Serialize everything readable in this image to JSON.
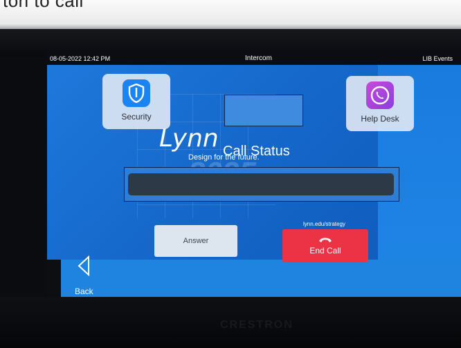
{
  "caption": {
    "text": "ton to call"
  },
  "topbar": {
    "datetime": "08-05-2022 12:42 PM",
    "title": "Intercom",
    "room": "LIB Events"
  },
  "background_branding": {
    "wordmark": "Lynn",
    "tagline": "Design for the future.",
    "year": "2025",
    "url": "lynn.edu/strategy"
  },
  "tiles": {
    "security": {
      "label": "Security",
      "icon": "shield-icon",
      "color": "#1c84f0"
    },
    "helpdesk": {
      "label": "Help Desk",
      "icon": "phone-icon",
      "color": "#b048dc"
    }
  },
  "call": {
    "status_label": "Call Status",
    "status_value": ""
  },
  "buttons": {
    "answer": {
      "label": "Answer"
    },
    "end_call": {
      "label": "End Call",
      "icon": "hang-up-icon",
      "color": "#ec3345"
    },
    "back": {
      "label": "Back",
      "icon": "back-arrow-icon"
    }
  },
  "device": {
    "brand": "CRESTRON"
  }
}
